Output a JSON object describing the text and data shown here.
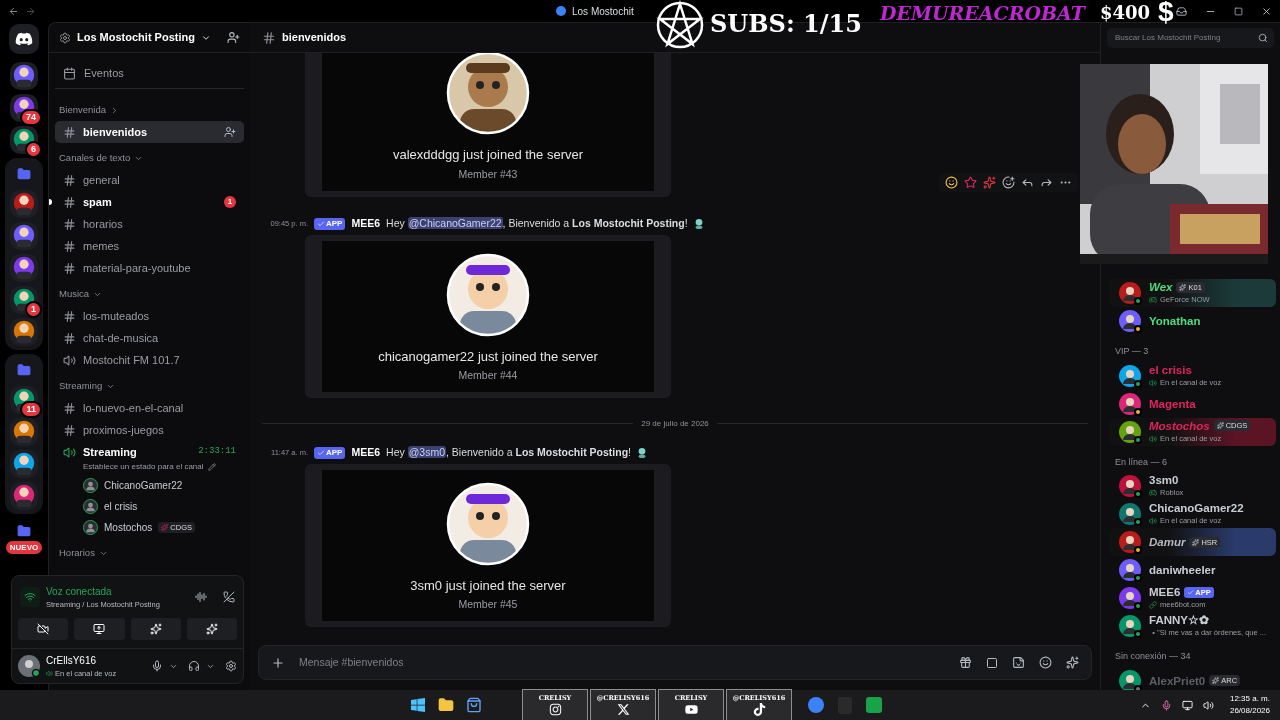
{
  "titlebar": {
    "title": "Los Mostochit"
  },
  "overlay": {
    "subs": "SUBS: 1/15",
    "streamer": "DEMUREACROBAT",
    "amount": "$400",
    "dollar": "$"
  },
  "servers": [
    {
      "kind": "home"
    },
    {
      "kind": "server"
    },
    {
      "kind": "server",
      "badge": "74"
    },
    {
      "kind": "server",
      "badge": "6"
    },
    {
      "kind": "folder",
      "children": [
        {
          "kind": "server"
        },
        {
          "kind": "server"
        },
        {
          "kind": "server"
        },
        {
          "kind": "server",
          "badge": "1"
        },
        {
          "kind": "server"
        }
      ]
    },
    {
      "kind": "folder",
      "children": [
        {
          "kind": "server",
          "badge": "11"
        },
        {
          "kind": "server"
        },
        {
          "kind": "server"
        },
        {
          "kind": "server"
        }
      ]
    },
    {
      "kind": "new",
      "label": "NUEVO"
    }
  ],
  "sidebar": {
    "server_name": "Los Mostochit Posting",
    "items": [
      {
        "kind": "event",
        "label": "Eventos"
      },
      {
        "kind": "category",
        "label": "Bienvenida",
        "expanded": false
      },
      {
        "kind": "channel",
        "label": "bienvenidos",
        "selected": true,
        "unread": false
      },
      {
        "kind": "category",
        "label": "Canales de texto",
        "expanded": true
      },
      {
        "kind": "channel",
        "label": "general",
        "selected": false,
        "unread": false
      },
      {
        "kind": "channel",
        "label": "spam",
        "selected": false,
        "unread": true,
        "badge": "1"
      },
      {
        "kind": "channel",
        "label": "horarios",
        "selected": false,
        "unread": false
      },
      {
        "kind": "channel",
        "label": "memes",
        "selected": false,
        "unread": false
      },
      {
        "kind": "channel",
        "label": "material-para-youtube",
        "selected": false,
        "unread": false
      },
      {
        "kind": "category",
        "label": "Musica",
        "expanded": true
      },
      {
        "kind": "channel",
        "label": "los-muteados",
        "selected": false,
        "unread": false
      },
      {
        "kind": "channel",
        "label": "chat-de-musica",
        "selected": false,
        "unread": false
      },
      {
        "kind": "voice",
        "label": "Mostochit FM 101.7",
        "active": false
      },
      {
        "kind": "category",
        "label": "Streaming",
        "expanded": true
      },
      {
        "kind": "channel",
        "label": "lo-nuevo-en-el-canal",
        "selected": false,
        "unread": false
      },
      {
        "kind": "channel",
        "label": "proximos-juegos",
        "selected": false,
        "unread": false
      },
      {
        "kind": "voice",
        "label": "Streaming",
        "active": true,
        "timer": "2:33:11",
        "status": "Establece un estado para el canal"
      },
      {
        "kind": "voice_user",
        "label": "ChicanoGamer22"
      },
      {
        "kind": "voice_user",
        "label": "el crisis"
      },
      {
        "kind": "voice_user",
        "label": "Mostochos",
        "tag": "CDGS"
      },
      {
        "kind": "category",
        "label": "Horarios",
        "expanded": true
      }
    ]
  },
  "voice_panel": {
    "title": "Voz conectada",
    "location": "Streaming / Los Mostochit Posting"
  },
  "user": {
    "name": "CrEllsY616",
    "status": "En el canal de voz"
  },
  "channel": {
    "name": "bienvenidos"
  },
  "messages": [
    {
      "kind": "card",
      "title": "valexdddgg just joined the server",
      "member": "Member #43"
    },
    {
      "kind": "message",
      "time": "09:45 p. m.",
      "badge": "APP",
      "author": "MEE6",
      "prefix": "Hey",
      "mention": "@ChicanoGamer22",
      "rest": ", Bienvenido a **Los Mostochit Posting**!"
    },
    {
      "kind": "card",
      "title": "chicanogamer22 just joined the server",
      "member": "Member #44"
    },
    {
      "kind": "divider",
      "label": "29 de julio de 2026"
    },
    {
      "kind": "message",
      "time": "11:47 a. m.",
      "badge": "APP",
      "author": "MEE6",
      "prefix": "Hey",
      "mention": "@3sm0",
      "rest": ", Bienvenido a **Los Mostochit Posting**!"
    },
    {
      "kind": "card",
      "title": "3sm0 just joined the server",
      "member": "Member #45"
    }
  ],
  "composer": {
    "placeholder": "Mensaje #bienvenidos"
  },
  "search": {
    "placeholder": "Buscar Los Mostochit Posting"
  },
  "members": {
    "groups": [
      {
        "members": [
          {
            "name": "Wex",
            "color": "#4ade80",
            "status": {
              "kind": "online"
            },
            "tag": "K01",
            "activity": {
              "kind": "game",
              "text": "GeForce NOW"
            },
            "fancy": true,
            "nameplate": {
              "color": "#1c3a3a"
            }
          },
          {
            "name": "Yonathan",
            "color": "#4ade80",
            "status": {
              "kind": "idle"
            },
            "fancy": false
          }
        ]
      },
      {
        "header": "VIP — 3",
        "members": [
          {
            "name": "el crisis",
            "color": "#e0245e",
            "status": {
              "kind": "online"
            },
            "activity": {
              "kind": "voice",
              "text": "En el canal de voz"
            },
            "fancy": false
          },
          {
            "name": "Magenta",
            "color": "#e0245e",
            "status": {
              "kind": "idle"
            },
            "fancy": false
          },
          {
            "name": "Mostochos",
            "color": "#e0245e",
            "status": {
              "kind": "online"
            },
            "tag": "CDGS",
            "activity": {
              "kind": "voice",
              "text": "En el canal de voz"
            },
            "fancy": true,
            "nameplate": {
              "color": "#5a1424"
            }
          }
        ]
      },
      {
        "header": "En línea — 6",
        "members": [
          {
            "name": "3sm0",
            "color": "#c9cdd4",
            "status": {
              "kind": "online"
            },
            "activity": {
              "kind": "game",
              "text": "Roblox"
            },
            "fancy": false
          },
          {
            "name": "ChicanoGamer22",
            "color": "#c9cdd4",
            "status": {
              "kind": "mobile"
            },
            "activity": {
              "kind": "voice",
              "text": "En el canal de voz"
            },
            "fancy": false
          },
          {
            "name": "Damur",
            "color": "#b5bac1",
            "status": {
              "kind": "idle"
            },
            "tag": "HSR",
            "fancy": true,
            "nameplate": {
              "color": "#2a3a6a"
            }
          },
          {
            "name": "daniwheeler",
            "color": "#c9cdd4",
            "status": {
              "kind": "online"
            },
            "fancy": false
          },
          {
            "name": "MEE6",
            "color": "#c9cdd4",
            "status": {
              "kind": "online"
            },
            "app": "APP",
            "activity": {
              "kind": "link",
              "text": "mee6bot.com"
            },
            "fancy": false
          },
          {
            "name": "FANNY☆✿",
            "color": "#c9cdd4",
            "status": {
              "kind": "online"
            },
            "activity": {
              "kind": "game",
              "text": "• \"Si me vas a dar órdenes, que ..."
            },
            "fancy": false
          }
        ]
      },
      {
        "header": "Sin conexión — 34",
        "members": [
          {
            "name": "AlexPriet0",
            "color": "#5c5f66",
            "status": {
              "kind": "offline"
            },
            "tag": "ARC",
            "fancy": false
          }
        ]
      }
    ]
  },
  "socials": [
    {
      "label": "CRELISY"
    },
    {
      "label": "@CRELISY616"
    },
    {
      "label": "CRELISY"
    },
    {
      "label": "@CRELISY616"
    }
  ],
  "clock": {
    "time": "12:35 a. m.",
    "date": "26/08/2026"
  }
}
